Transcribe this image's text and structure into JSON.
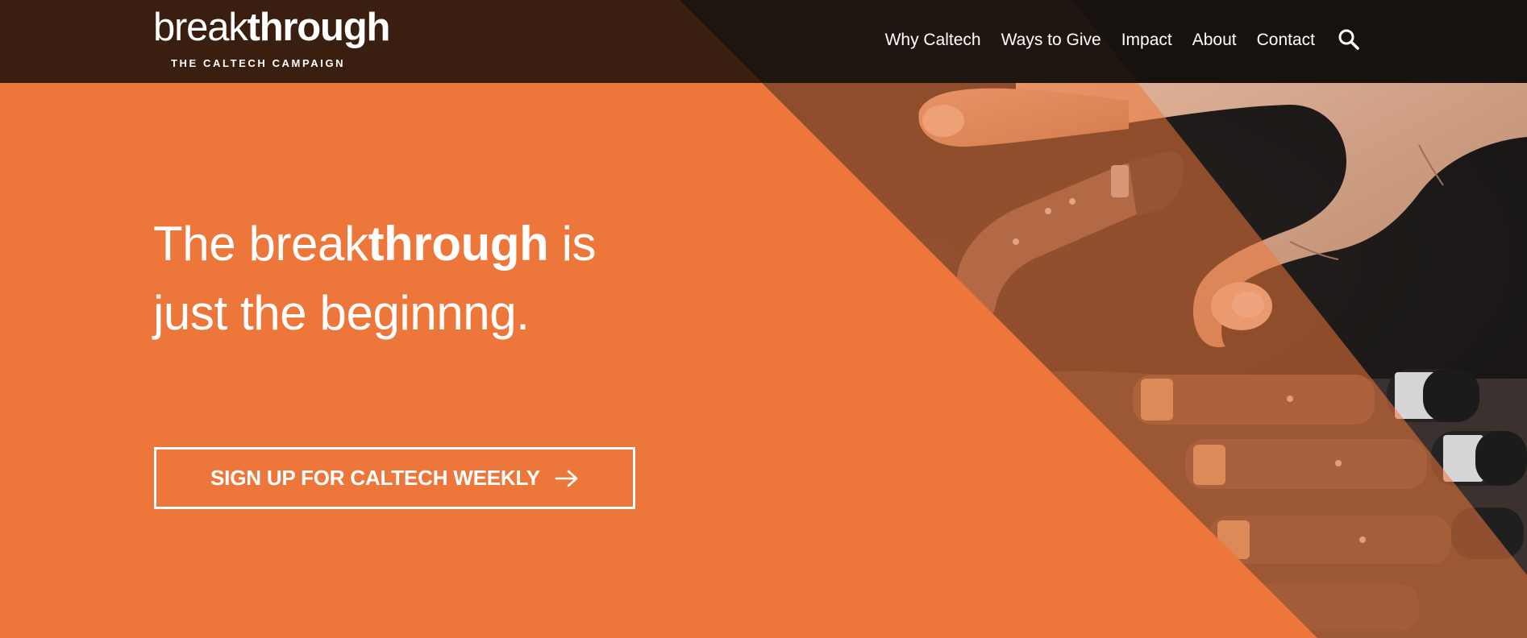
{
  "header": {
    "logo": {
      "word_light": "break",
      "word_bold": "through",
      "tagline": "THE CALTECH CAMPAIGN"
    },
    "nav": [
      {
        "label": "Why Caltech"
      },
      {
        "label": "Ways to Give"
      },
      {
        "label": "Impact"
      },
      {
        "label": "About"
      },
      {
        "label": "Contact"
      }
    ],
    "search_icon": "search-icon"
  },
  "hero": {
    "headline": {
      "part1": "The ",
      "part2_light": "break",
      "part3_bold": "through",
      "part4": " is",
      "line2": "just the beginnng."
    },
    "cta": {
      "label": "SIGN UP FOR CALTECH WEEKLY",
      "icon": "arrow-right-icon"
    },
    "image_subject": "prosthetic robotic hand reaching toward human hand",
    "colors": {
      "orange": "#ED773A",
      "header_brown": "#3A1E10",
      "header_dark": "#18120F",
      "photo_dark": "#141414"
    }
  }
}
